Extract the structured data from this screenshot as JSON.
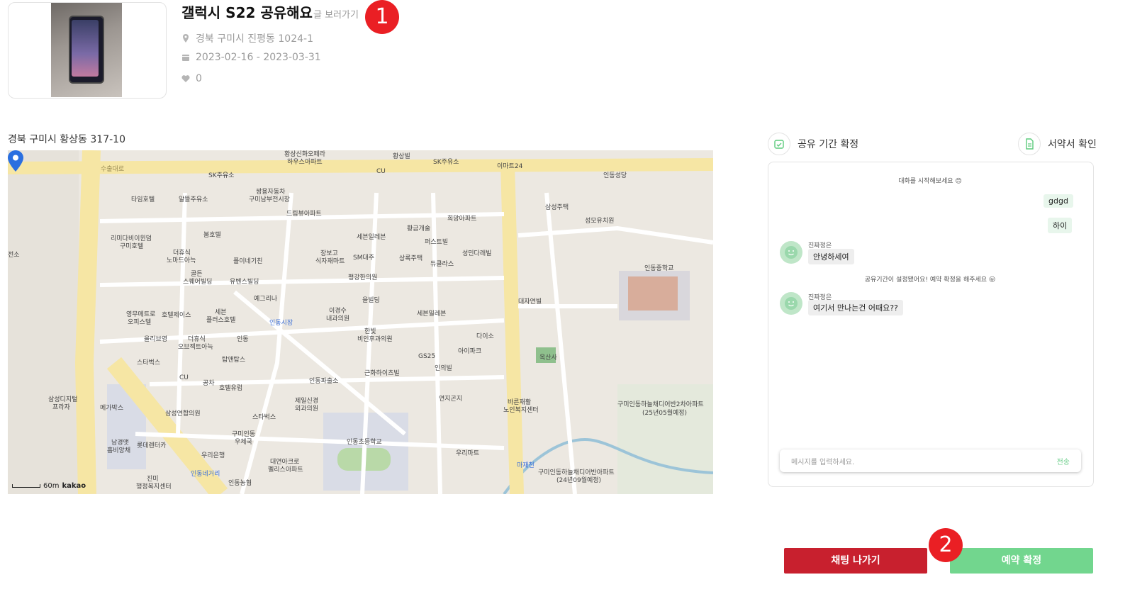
{
  "post": {
    "title": "갤럭시 S22 공유해요",
    "view_post_label": "글 보러가기",
    "location": "경북 구미시 진평동 1024-1",
    "period": "2023-02-16 - 2023-03-31",
    "likes": "0",
    "thumbnail_alt": "갤럭시 S22 사진"
  },
  "annotations": {
    "badge1": "1",
    "badge2": "2"
  },
  "map": {
    "address_label": "경북 구미시 황상동 317-10",
    "scale_text": "60m",
    "brand": "kakao",
    "labels": [
      "황상신화오페라",
      "하우스아파트",
      "SK주유소",
      "황상빌",
      "이마트24",
      "CU",
      "수출대로",
      "SK주유소",
      "타임호텔",
      "알뜰주유소",
      "쌍용자동차",
      "구미남부전시장",
      "드림뷰아파트",
      "희망아파트",
      "황금개술",
      "세븐일레븐",
      "퍼스트빌",
      "삼성주택",
      "인동성당",
      "성모유치원",
      "리미다비이윈덤",
      "구미호텔",
      "붐호텔",
      "더휴식",
      "노마드아늑",
      "폴이네기친",
      "장보고",
      "식자재마트",
      "SM대주",
      "상록주택",
      "듀클라스",
      "성민다래빌",
      "인동중학교",
      "평강한의원",
      "골든",
      "스퀘어빌딩",
      "유벤스빌딩",
      "예그리나",
      "을빌딩",
      "대자연빌",
      "영무메트로",
      "오피스텔",
      "호텔제이스",
      "세븐",
      "플러스호텔",
      "이경수",
      "내과의원",
      "세븐일레븐",
      "인동시장",
      "한빛",
      "비인후과의원",
      "다이소",
      "아이파크",
      "올리브영",
      "더휴식",
      "오브젝트아늑",
      "탑앤탑스",
      "인동",
      "GS25",
      "인의빌",
      "옥산사",
      "스타벅스",
      "CU",
      "공차",
      "호텔유럽",
      "근화하이츠빌",
      "인동파출소",
      "제일신경",
      "외과의원",
      "연지곤지",
      "바른재활",
      "노인복지센터",
      "삼성디지털",
      "프라자",
      "메가박스",
      "삼성연합의원",
      "스타벅스",
      "구미인동",
      "우체국",
      "인동초등학교",
      "우리마트",
      "구미인동하늘채디어반2차아파트",
      "(25년05월예정)",
      "남경앳",
      "홈비앙채",
      "롯데렌터카",
      "우리은행",
      "대연아크로",
      "펠리스아파트",
      "진미",
      "행정복지센터",
      "인동네거리",
      "인동농협",
      "구미인동하늘채디어반아파트",
      "(24년09월예정)",
      "마재천",
      "전소"
    ]
  },
  "panel": {
    "confirm_period_label": "공유 기간 확정",
    "contract_label": "서약서 확인",
    "system_start": "대화를 시작해보세요 😊",
    "my_messages": [
      "gdgd",
      "하이"
    ],
    "peer_name": "진짜정은",
    "peer_messages": [
      "안녕하세여",
      "여기서 만나는건 어때요??"
    ],
    "system_period": "공유기간이 설정됐어요! 예약 확정을 해주세요 😛",
    "input_placeholder": "메시지를 입력하세요.",
    "send_label": "전송"
  },
  "buttons": {
    "leave_chat": "채팅 나가기",
    "confirm_reservation": "예약 확정"
  },
  "colors": {
    "danger": "#c8202e",
    "success": "#72d68e",
    "badge": "#ea1f24",
    "chat_mine_bg": "#e8f6ec"
  }
}
